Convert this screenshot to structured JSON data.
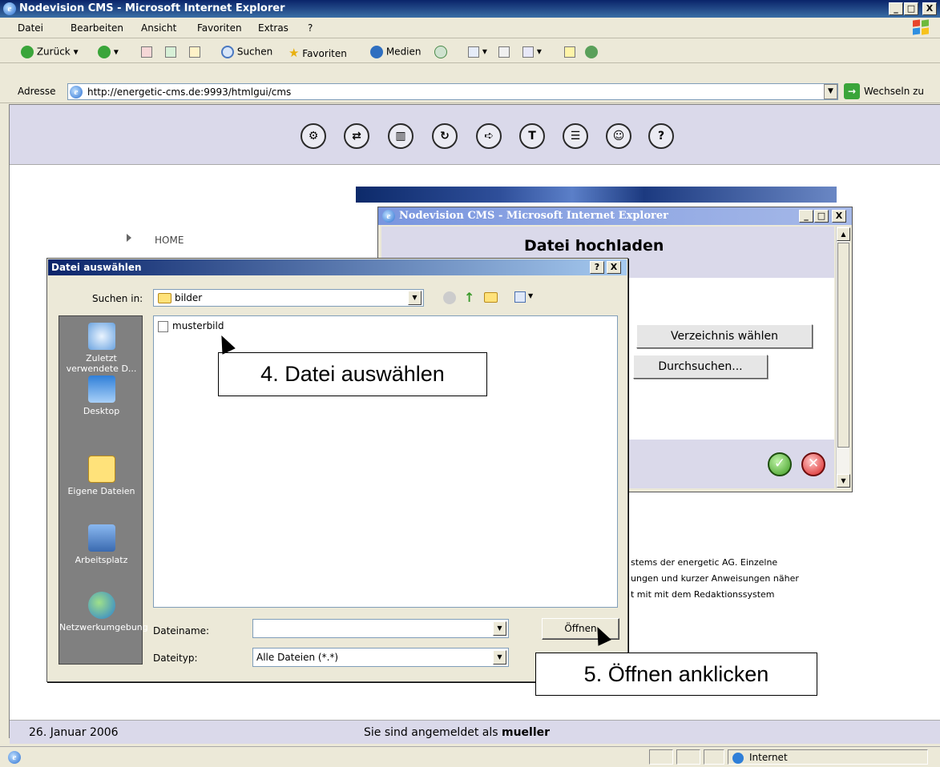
{
  "window": {
    "title": "Nodevision CMS - Microsoft Internet Explorer",
    "min": "_",
    "max": "□",
    "close": "X"
  },
  "menu": [
    "Datei",
    "Bearbeiten",
    "Ansicht",
    "Favoriten",
    "Extras",
    "?"
  ],
  "toolbar": {
    "back": "Zurück",
    "search": "Suchen",
    "favorites": "Favoriten",
    "media": "Medien"
  },
  "address": {
    "label": "Adresse",
    "url": "http://energetic-cms.de:9993/htmlgui/cms",
    "go": "Wechseln zu"
  },
  "cms": {
    "icons": [
      "settings-icon",
      "move-icon",
      "delete-icon",
      "sync-icon",
      "forward-icon",
      "tool-icon",
      "tree-icon",
      "users-icon",
      "help-icon"
    ],
    "help_glyph": "?",
    "home": "HOME",
    "text_lines": [
      "stems der energetic AG. Einzelne",
      "ungen und kurzer Anweisungen näher",
      "t mit mit dem Redaktionssystem"
    ]
  },
  "popup": {
    "title": "Nodevision CMS - Microsoft Internet Explorer",
    "heading": "Datei hochladen",
    "choose_dir": "Verzeichnis wählen",
    "browse": "Durchsuchen..."
  },
  "dialog": {
    "title": "Datei auswählen",
    "help": "?",
    "close": "X",
    "lookin_label": "Suchen in:",
    "lookin_value": "bilder",
    "places": [
      "Zuletzt verwendete D...",
      "Desktop",
      "Eigene Dateien",
      "Arbeitsplatz",
      "Netzwerkumgebung"
    ],
    "files": [
      "musterbild"
    ],
    "filename_label": "Dateiname:",
    "filename_value": "",
    "filetype_label": "Dateityp:",
    "filetype_value": "Alle Dateien (*.*)",
    "open": "Öffnen"
  },
  "callouts": {
    "step4": "4. Datei auswählen",
    "step5": "5. Öffnen anklicken"
  },
  "footer": {
    "date": "26. Januar 2006",
    "login_text": "Sie sind angemeldet als",
    "user": "mueller"
  },
  "status": {
    "zone": "Internet"
  }
}
